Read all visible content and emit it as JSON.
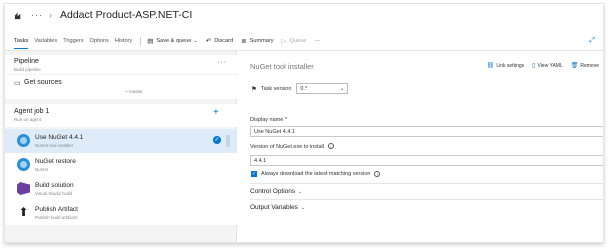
{
  "header": {
    "title": "Addact Product-ASP.NET-CI",
    "pipeline_icon": "pipeline-icon",
    "more_icon": "more-icon"
  },
  "tabs": [
    "Tasks",
    "Variables",
    "Triggers",
    "Options",
    "History"
  ],
  "toolbar": {
    "save_label": "Save & queue",
    "discard_label": "Discard",
    "summary_label": "Summary",
    "queue_label": "Queue",
    "more_label": "···"
  },
  "left": {
    "pipeline": {
      "name": "Pipeline",
      "sub": "Build pipeline"
    },
    "get_sources": {
      "name": "Get sources",
      "branch": "master"
    },
    "agent_job": {
      "name": "Agent job 1",
      "sub": "Run on agent"
    },
    "tasks": [
      {
        "name": "Use NuGet 4.4.1",
        "sub": "NuGet tool installer",
        "icon": "nuget-icon",
        "selected": true
      },
      {
        "name": "NuGet restore",
        "sub": "NuGet",
        "icon": "nuget-icon",
        "selected": false
      },
      {
        "name": "Build solution",
        "sub": "Visual Studio build",
        "icon": "visual-studio-icon",
        "selected": false
      },
      {
        "name": "Publish Artifact",
        "sub": "Publish build artifacts",
        "icon": "upload-icon",
        "selected": false
      }
    ]
  },
  "right": {
    "title": "NuGet tool installer",
    "link_settings": "Link settings",
    "view_yaml": "View YAML",
    "remove": "Remove",
    "task_version_label": "Task version",
    "task_version_value": "0.*",
    "display_name_label": "Display name *",
    "display_name_value": "Use NuGet 4.4.1",
    "version_label": "Version of NuGet.exe to install",
    "version_value": "4.4.1",
    "checkbox_label": "Always download the latest matching version",
    "checkbox_checked": true,
    "control_options": "Control Options",
    "output_variables": "Output Variables"
  },
  "colors": {
    "accent": "#0078d4",
    "selected_row": "#deecf9",
    "left_bg": "#f4f4f4"
  }
}
